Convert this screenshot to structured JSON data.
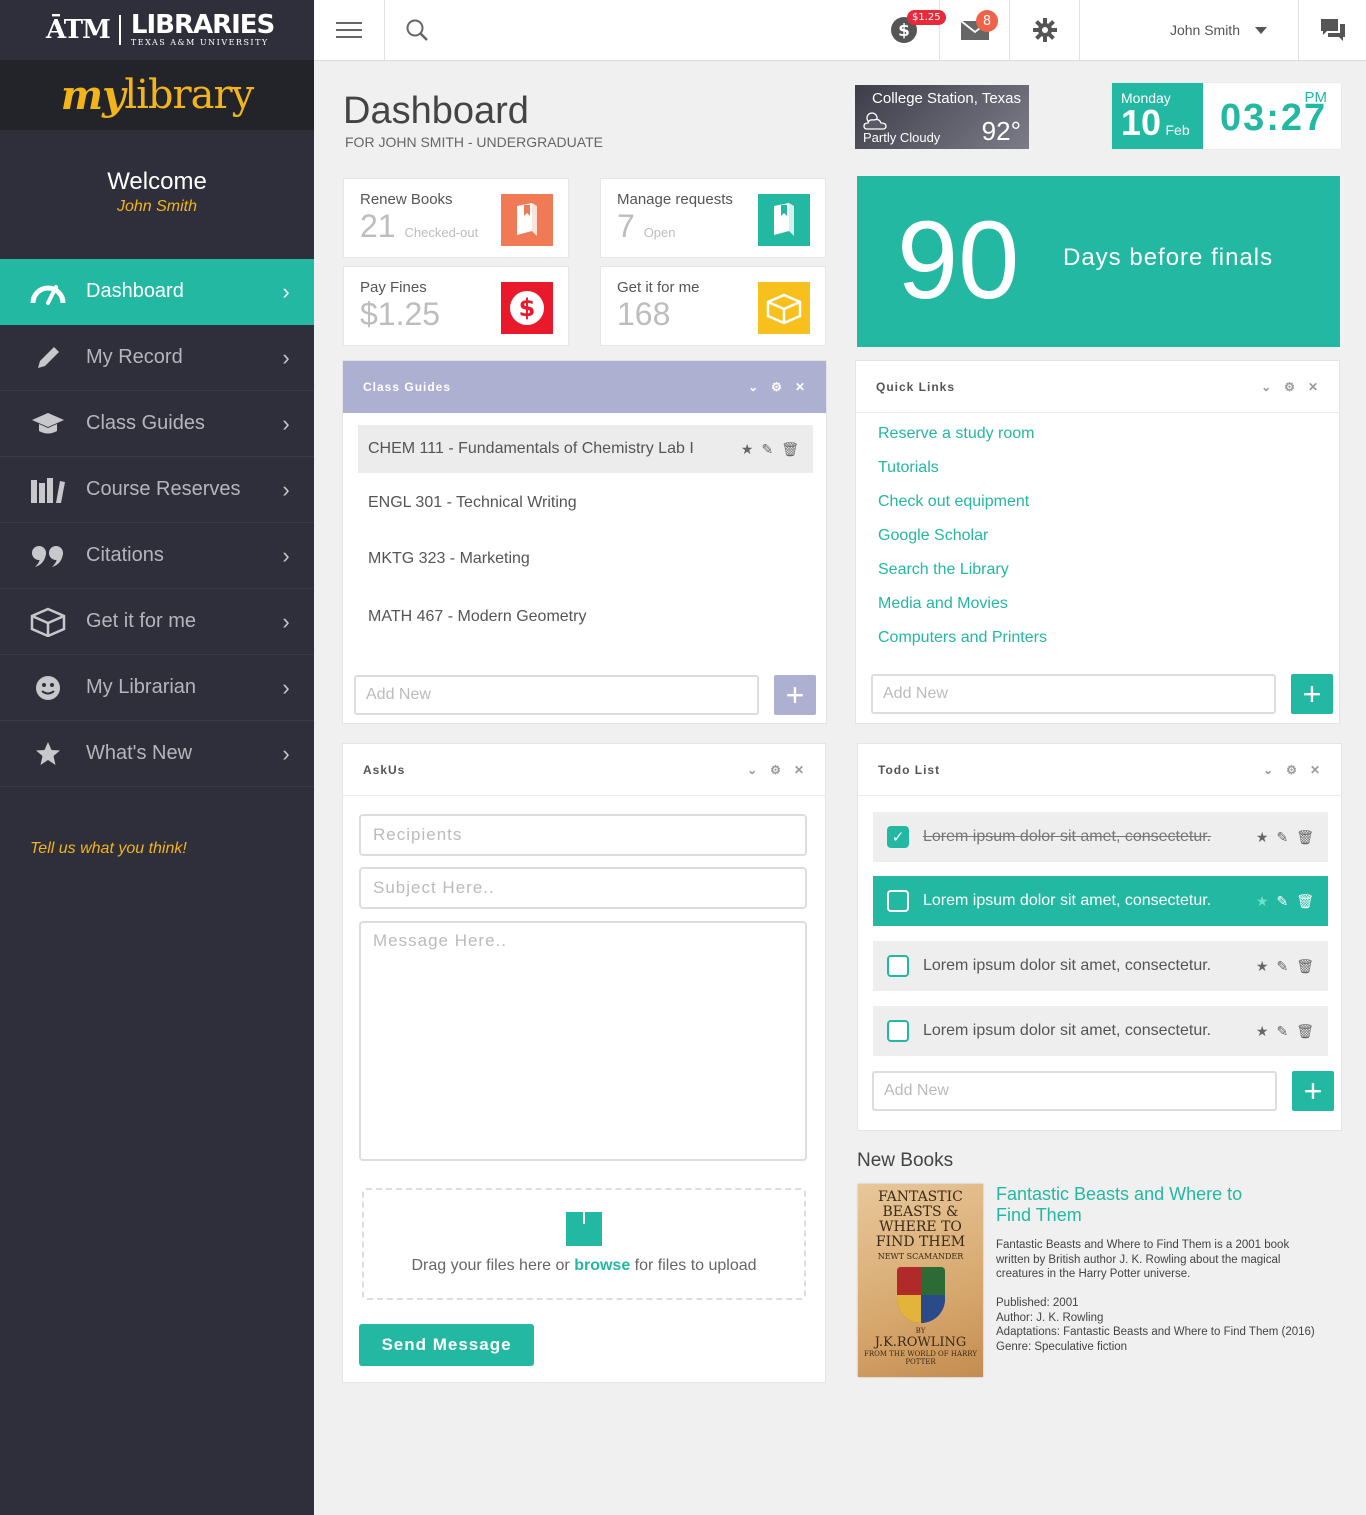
{
  "brand": {
    "atm": "ĀTM",
    "libraries": "LIBRARIES",
    "university": "TEXAS A&M UNIVERSITY",
    "my": "my",
    "library": "library"
  },
  "welcome": {
    "title": "Welcome",
    "name": "John Smith"
  },
  "nav": [
    {
      "label": "Dashboard",
      "icon": "gauge-icon",
      "active": true
    },
    {
      "label": "My Record",
      "icon": "pencil-icon"
    },
    {
      "label": "Class Guides",
      "icon": "graduation-cap-icon"
    },
    {
      "label": "Course Reserves",
      "icon": "books-icon"
    },
    {
      "label": "Citations",
      "icon": "quote-icon"
    },
    {
      "label": "Get it for me",
      "icon": "package-icon"
    },
    {
      "label": "My Librarian",
      "icon": "smiley-icon"
    },
    {
      "label": "What's New",
      "icon": "star-icon"
    }
  ],
  "feedback": "Tell us what you think!",
  "topbar": {
    "fines_badge": "$1.25",
    "mail_badge": "8",
    "user": "John Smith"
  },
  "header": {
    "title": "Dashboard",
    "subtitle": "FOR JOHN SMITH - UNDERGRADUATE"
  },
  "weather": {
    "location": "College Station, Texas",
    "condition": "Partly Cloudy",
    "temp": "92°"
  },
  "clock": {
    "day": "Monday",
    "date": "10",
    "month": "Feb",
    "time": "03:27",
    "ampm": "PM"
  },
  "stats": {
    "renew": {
      "title": "Renew Books",
      "value": "21",
      "unit": "Checked-out"
    },
    "requests": {
      "title": "Manage requests",
      "value": "7",
      "unit": "Open"
    },
    "fines": {
      "title": "Pay Fines",
      "value": "$1.25"
    },
    "getit": {
      "title": "Get it for me",
      "value": "168"
    }
  },
  "finals": {
    "days": "90",
    "text": "Days before finals"
  },
  "class_guides": {
    "title": "Class Guides",
    "items": [
      "CHEM 111 - Fundamentals of Chemistry Lab I",
      "ENGL 301 - Technical Writing",
      "MKTG 323 - Marketing",
      "MATH 467 - Modern Geometry"
    ],
    "add_placeholder": "Add New"
  },
  "quick_links": {
    "title": "Quick Links",
    "items": [
      "Reserve a study room",
      "Tutorials",
      "Check out equipment",
      "Google Scholar",
      "Search the Library",
      "Media and Movies",
      "Computers and Printers"
    ],
    "add_placeholder": "Add New"
  },
  "askus": {
    "title": "AskUs",
    "recipients": "Recipients",
    "subject": "Subject Here..",
    "message": "Message Here..",
    "upload_prefix": "Drag your files here or",
    "upload_link": "browse",
    "upload_suffix": "for files to upload",
    "send": "Send Message"
  },
  "todo": {
    "title": "Todo List",
    "items": [
      {
        "text": "Lorem ipsum dolor sit amet, consectetur.",
        "done": true
      },
      {
        "text": "Lorem ipsum dolor sit amet, consectetur.",
        "selected": true
      },
      {
        "text": "Lorem ipsum dolor sit amet, consectetur."
      },
      {
        "text": "Lorem ipsum dolor sit amet, consectetur."
      }
    ],
    "add_placeholder": "Add New"
  },
  "new_books": {
    "title": "New Books",
    "cover": {
      "line1": "FANTASTIC BEASTS & WHERE TO FIND THEM",
      "author_small": "NEWT SCAMANDER",
      "by": "BY",
      "author": "J.K.ROWLING",
      "series": "FROM THE WORLD OF HARRY POTTER"
    },
    "book_title": "Fantastic Beasts and Where to Find Them",
    "description": "Fantastic Beasts and Where to Find Them is a 2001 book written by British author J. K. Rowling about the magical creatures in the Harry Potter universe.",
    "published": "Published: 2001",
    "author": "Author: J. K. Rowling",
    "adaptations": "Adaptations: Fantastic Beasts and Where to Find Them (2016)",
    "genre": "Genre: Speculative fiction"
  },
  "colors": {
    "accent": "#23b8a2",
    "sidebar": "#2e2f3b",
    "gold": "#f3b41b",
    "purple": "#adb0d0",
    "danger": "#e8293a",
    "warning": "#f7c01d",
    "coral": "#f07a56"
  }
}
